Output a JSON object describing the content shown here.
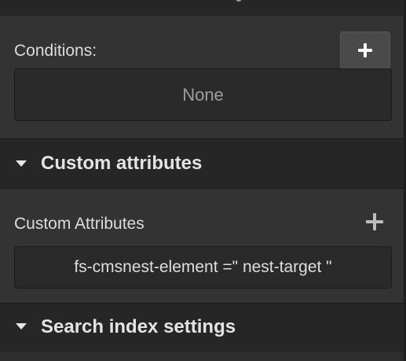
{
  "conditions": {
    "label": "Conditions:",
    "add_icon": "plus-icon",
    "empty_value": "None"
  },
  "custom_attributes_section": {
    "title": "Custom attributes",
    "expanded": true,
    "caret_icon": "caret-down-icon",
    "field_label": "Custom Attributes",
    "add_icon": "plus-icon",
    "attributes": [
      {
        "name": "fs-cmsnest-element",
        "separator": " =\" ",
        "value": "nest-target",
        "closing": " \""
      }
    ]
  },
  "search_index_section": {
    "title": "Search index settings",
    "caret_icon": "caret-down-icon"
  },
  "colors": {
    "panel_bg": "#333333",
    "header_bg": "#262626",
    "field_bg": "#2a2a2a",
    "text": "#e4e4e4",
    "muted": "#9e9e9e"
  }
}
